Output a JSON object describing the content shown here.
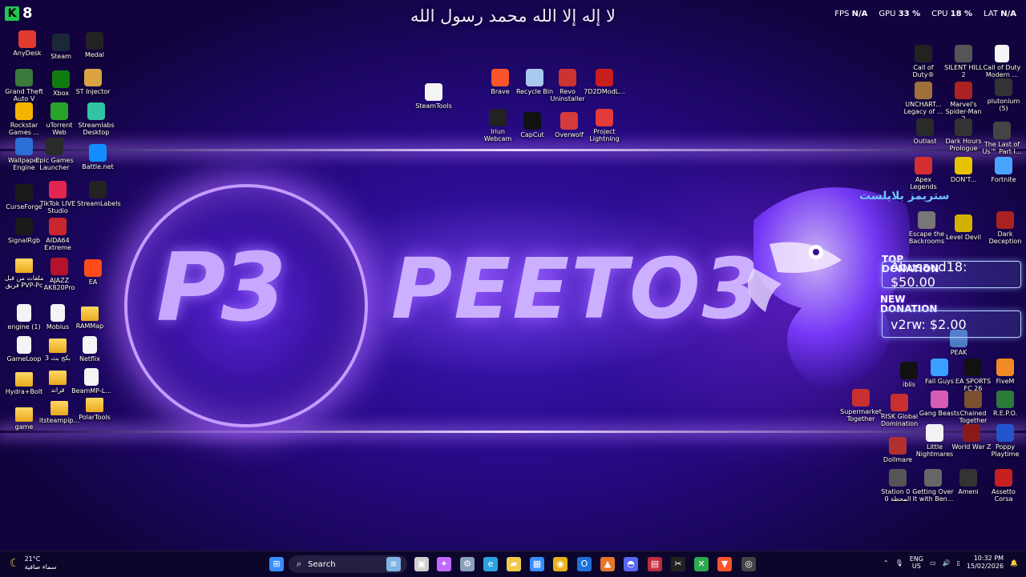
{
  "header": {
    "arabic_text": "لا إله إلا الله محمد رسول الله",
    "k_logo": "K",
    "k_count": "8"
  },
  "perf": {
    "fps_label": "FPS",
    "fps_value": "N/A",
    "gpu_label": "GPU",
    "gpu_value": "33 %",
    "cpu_label": "CPU",
    "cpu_value": "18 %",
    "lat_label": "LAT",
    "lat_value": "N/A"
  },
  "wallpaper": {
    "badge_text": "P3",
    "brand_text": "PEETO3"
  },
  "desktop_icons_left": [
    {
      "label": "AnyDesk",
      "icon": "anydesk-icon",
      "color": "#e03b2f"
    },
    {
      "label": "Steam",
      "icon": "steam-icon",
      "color": "#1b2838"
    },
    {
      "label": "Medal",
      "icon": "medal-icon",
      "color": "#222222"
    },
    {
      "label": "Grand Theft Auto V",
      "icon": "gta-icon",
      "color": "#3a7a3a"
    },
    {
      "label": "Xbox",
      "icon": "xbox-icon",
      "color": "#107c10"
    },
    {
      "label": "ST Injector",
      "icon": "injector-icon",
      "color": "#d9a441"
    },
    {
      "label": "Rockstar Games ...",
      "icon": "rockstar-icon",
      "color": "#f6b400"
    },
    {
      "label": "uTorrent Web",
      "icon": "utorrent-icon",
      "color": "#2aa32a"
    },
    {
      "label": "Streamlabs Desktop",
      "icon": "streamlabs-icon",
      "color": "#31c3a2"
    },
    {
      "label": "Wallpaper Engine",
      "icon": "wallpaper-engine-icon",
      "color": "#2b6fd6"
    },
    {
      "label": "Epic Games Launcher",
      "icon": "epic-icon",
      "color": "#2a2a2a"
    },
    {
      "label": "Battle.net",
      "icon": "battlenet-icon",
      "color": "#148eff"
    },
    {
      "label": "CurseForge",
      "icon": "curseforge-icon",
      "color": "#1a1a1a"
    },
    {
      "label": "TikTok LIVE Studio",
      "icon": "tiktok-icon",
      "color": "#e02651"
    },
    {
      "label": "StreamLabels",
      "icon": "streamlabels-icon",
      "color": "#222222"
    },
    {
      "label": "SignalRgb",
      "icon": "signalrgb-icon",
      "color": "#1a1a1a"
    },
    {
      "label": "AIDA64 Extreme",
      "icon": "aida64-icon",
      "color": "#c8272e"
    },
    {
      "label": "ملفات من قبل فريق PVP-Pc",
      "icon": "folder-icon",
      "color": "#e8a91c"
    },
    {
      "label": "AJAZZ AK820Pro",
      "icon": "ajazz-icon",
      "color": "#b5122b"
    },
    {
      "label": "EA",
      "icon": "ea-icon",
      "color": "#ff4a1a"
    },
    {
      "label": "engine (1)",
      "icon": "document-icon",
      "color": "#f4f4f4"
    },
    {
      "label": "Mobius",
      "icon": "document-icon",
      "color": "#f4f4f4"
    },
    {
      "label": "RAMMap",
      "icon": "folder-icon",
      "color": "#e8a91c"
    },
    {
      "label": "GameLoop",
      "icon": "document-icon",
      "color": "#f4f4f4"
    },
    {
      "label": "بكج بث 3",
      "icon": "folder-icon",
      "color": "#e8a91c"
    },
    {
      "label": "Netflix",
      "icon": "document-icon",
      "color": "#f4f4f4"
    },
    {
      "label": "Hydra+Bolt",
      "icon": "folder-icon",
      "color": "#e8a91c"
    },
    {
      "label": "قراند",
      "icon": "folder-icon",
      "color": "#e8a91c"
    },
    {
      "label": "BeamMP-L...",
      "icon": "document-icon",
      "color": "#f4f4f4"
    },
    {
      "label": "game",
      "icon": "folder-icon",
      "color": "#e8a91c"
    },
    {
      "label": "itsteampip...",
      "icon": "folder-icon",
      "color": "#e8a91c"
    },
    {
      "label": "PolarTools",
      "icon": "folder-icon",
      "color": "#e8a91c"
    }
  ],
  "desktop_icons_center": [
    {
      "label": "SteamTools",
      "icon": "steamtools-icon",
      "color": "#f4f4f4"
    },
    {
      "label": "Brave",
      "icon": "brave-icon",
      "color": "#fb542b"
    },
    {
      "label": "Recycle Bin",
      "icon": "recycle-bin-icon",
      "color": "#a8c8ee"
    },
    {
      "label": "Revo Uninstaller",
      "icon": "revo-icon",
      "color": "#cc3333"
    },
    {
      "label": "7D2DModL...",
      "icon": "mod-icon",
      "color": "#c81e1e"
    },
    {
      "label": "Iriun Webcam",
      "icon": "webcam-icon",
      "color": "#222222"
    },
    {
      "label": "CapCut",
      "icon": "capcut-icon",
      "color": "#111111"
    },
    {
      "label": "Overwolf",
      "icon": "overwolf-icon",
      "color": "#d43b3b"
    },
    {
      "label": "Project Lightning",
      "icon": "lightning-icon",
      "color": "#e33a3a"
    }
  ],
  "desktop_icons_right": [
    {
      "label": "Call of Duty®",
      "icon": "cod-icon",
      "color": "#222222"
    },
    {
      "label": "SILENT HILL 2",
      "icon": "silent-hill-icon",
      "color": "#555555"
    },
    {
      "label": "Call of Duty Modern ...",
      "icon": "document-icon",
      "color": "#f4f4f4"
    },
    {
      "label": "UNCHART... Legacy of ...",
      "icon": "uncharted-icon",
      "color": "#a0703a"
    },
    {
      "label": "Marvel's Spider-Man 2",
      "icon": "spiderman-icon",
      "color": "#aa2222"
    },
    {
      "label": "plutonium (5)",
      "icon": "plutonium-icon",
      "color": "#333333"
    },
    {
      "label": "Outlast",
      "icon": "outlast-icon",
      "color": "#2a2a2a"
    },
    {
      "label": "Dark Hours Prologue",
      "icon": "dark-hours-icon",
      "color": "#333333"
    },
    {
      "label": "The Last of Us™ Part I...",
      "icon": "tlou-icon",
      "color": "#444444"
    },
    {
      "label": "Apex Legends",
      "icon": "apex-icon",
      "color": "#d32f2f"
    },
    {
      "label": "DON'T...",
      "icon": "dont-icon",
      "color": "#e6c200"
    },
    {
      "label": "Fortnite",
      "icon": "fortnite-icon",
      "color": "#4aa3ff"
    },
    {
      "label": "Escape the Backrooms",
      "icon": "backrooms-icon",
      "color": "#777777"
    },
    {
      "label": "Level Devil",
      "icon": "level-devil-icon",
      "color": "#d2b200"
    },
    {
      "label": "Dark Deception",
      "icon": "dark-deception-icon",
      "color": "#aa2222"
    },
    {
      "label": "PEAK",
      "icon": "peak-icon",
      "color": "#4a7cc0"
    },
    {
      "label": "iblis",
      "icon": "iblis-icon",
      "color": "#111111"
    },
    {
      "label": "Fall Guys",
      "icon": "fall-guys-icon",
      "color": "#3aa0ff"
    },
    {
      "label": "EA SPORTS FC 26",
      "icon": "fc26-icon",
      "color": "#111111"
    },
    {
      "label": "FiveM",
      "icon": "fivem-icon",
      "color": "#f08a24"
    },
    {
      "label": "Supermarket Together",
      "icon": "supermarket-icon",
      "color": "#c83030"
    },
    {
      "label": "RISK Global Domination",
      "icon": "risk-icon",
      "color": "#c83030"
    },
    {
      "label": "Gang Beasts",
      "icon": "gang-beasts-icon",
      "color": "#d65db1"
    },
    {
      "label": "Chained Together",
      "icon": "chained-icon",
      "color": "#7a5230"
    },
    {
      "label": "R.E.P.O.",
      "icon": "repo-icon",
      "color": "#2b7a3a"
    },
    {
      "label": "Little Nightmares",
      "icon": "little-nightmares-icon",
      "color": "#f2f2f2"
    },
    {
      "label": "World War Z",
      "icon": "wwz-icon",
      "color": "#8a1a1a"
    },
    {
      "label": "Poppy Playtime",
      "icon": "poppy-icon",
      "color": "#2255cc"
    },
    {
      "label": "Dollmare",
      "icon": "dollmare-icon",
      "color": "#b03030"
    },
    {
      "label": "Station 0 - المحطة 0",
      "icon": "station-icon",
      "color": "#555555"
    },
    {
      "label": "Getting Over It with Ben...",
      "icon": "getting-over-it-icon",
      "color": "#666666"
    },
    {
      "label": "Ameni",
      "icon": "ameni-icon",
      "color": "#333333"
    },
    {
      "label": "Assetto Corsa",
      "icon": "assetto-icon",
      "color": "#c82020"
    }
  ],
  "donations": {
    "arabic_logo": "ستريمز بلايلست",
    "top_label": "TOP DONATION",
    "top_value": "Abusaud18: $50.00",
    "new_label": "NEW DONATION",
    "new_value": "v2rw: $2.00"
  },
  "taskbar": {
    "weather_temp": "21°C",
    "weather_desc": "سماء صافية",
    "search_placeholder": "Search",
    "lang": "ENG",
    "region": "US",
    "time": "10:32 PM",
    "date": "15/02/2026",
    "apps": [
      {
        "name": "start-button",
        "icon": "windows-icon",
        "color": "#3a8dff"
      },
      {
        "name": "taskbar-widget",
        "icon": "scene-icon",
        "color": "#7fb5e6"
      },
      {
        "name": "task-view-button",
        "icon": "task-view-icon",
        "color": "#cfcfcf"
      },
      {
        "name": "copilot-button",
        "icon": "copilot-icon",
        "color": "#c068ff"
      },
      {
        "name": "settings-button",
        "icon": "gear-icon",
        "color": "#8aa0b8"
      },
      {
        "name": "edge-button",
        "icon": "edge-icon",
        "color": "#2aa3e0"
      },
      {
        "name": "file-explorer-button",
        "icon": "folder-icon",
        "color": "#f2c94c"
      },
      {
        "name": "store-button",
        "icon": "store-icon",
        "color": "#3a8dff"
      },
      {
        "name": "chrome-button",
        "icon": "chrome-icon",
        "color": "#e8b21d"
      },
      {
        "name": "outlook-button",
        "icon": "outlook-icon",
        "color": "#1e70d6"
      },
      {
        "name": "warning-app-button",
        "icon": "warning-icon",
        "color": "#e8742a"
      },
      {
        "name": "discord-button",
        "icon": "discord-icon",
        "color": "#5865f2"
      },
      {
        "name": "app-button-red",
        "icon": "grid-icon",
        "color": "#c02b3b"
      },
      {
        "name": "capcut-button",
        "icon": "capcut-icon",
        "color": "#222222"
      },
      {
        "name": "xbox-button",
        "icon": "xbox-icon",
        "color": "#2fa84f"
      },
      {
        "name": "brave-button",
        "icon": "brave-icon",
        "color": "#fb542b"
      },
      {
        "name": "obs-button",
        "icon": "obs-icon",
        "color": "#444444"
      }
    ]
  }
}
